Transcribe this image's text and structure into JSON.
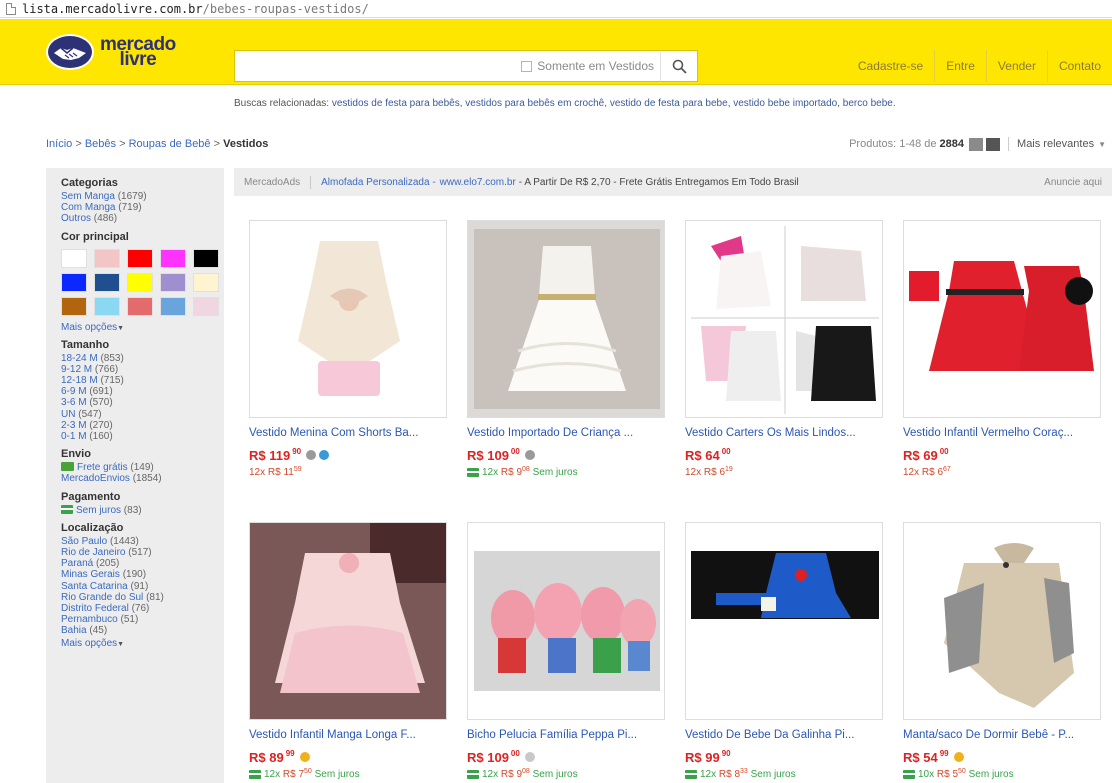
{
  "address_bar": {
    "host": "lista.mercadolivre.com.br",
    "path": "/bebes-roupas-vestidos/"
  },
  "header": {
    "logo_line1": "mercado",
    "logo_line2": "livre",
    "search_placeholder": "",
    "search_filter_label": "Somente em Vestidos",
    "nav": [
      "Cadastre-se",
      "Entre",
      "Vender",
      "Contato"
    ]
  },
  "related": {
    "label": "Buscas relacionadas:",
    "links": [
      "vestidos de festa para bebês",
      "vestidos para bebês em crochê",
      "vestido de festa para bebe",
      "vestido bebe importado",
      "berco bebe"
    ]
  },
  "breadcrumb": {
    "items": [
      "Início",
      "Bebês",
      "Roupas de Bebê"
    ],
    "current": "Vestidos"
  },
  "results": {
    "label": "Produtos:",
    "range": "1-48 de",
    "total": "2884",
    "sort": "Mais relevantes"
  },
  "sidebar": {
    "categories_title": "Categorias",
    "categories": [
      {
        "name": "Sem Manga",
        "count": "(1679)"
      },
      {
        "name": "Com Manga",
        "count": "(719)"
      },
      {
        "name": "Outros",
        "count": "(486)"
      }
    ],
    "color_title": "Cor principal",
    "colors": [
      "#ffffff",
      "#f2c6c4",
      "#ff0000",
      "#ff33ff",
      "#000000",
      "#0c28ff",
      "#1f4f8f",
      "#ffff00",
      "#9f8fcf",
      "#fff4d0",
      "#b0650e",
      "#8ad8f2",
      "#e36b6b",
      "#6aa4dc",
      "#f0d6e0"
    ],
    "more_options": "Mais opções",
    "size_title": "Tamanho",
    "sizes": [
      {
        "name": "18-24 M",
        "count": "(853)"
      },
      {
        "name": "9-12 M",
        "count": "(766)"
      },
      {
        "name": "12-18 M",
        "count": "(715)"
      },
      {
        "name": "6-9 M",
        "count": "(691)"
      },
      {
        "name": "3-6 M",
        "count": "(570)"
      },
      {
        "name": "UN",
        "count": "(547)"
      },
      {
        "name": "2-3 M",
        "count": "(270)"
      },
      {
        "name": "0-1 M",
        "count": "(160)"
      }
    ],
    "shipping_title": "Envio",
    "shipping": [
      {
        "name": "Frete grátis",
        "count": "(149)"
      },
      {
        "name": "MercadoEnvios",
        "count": "(1854)"
      }
    ],
    "payment_title": "Pagamento",
    "payment": [
      {
        "name": "Sem juros",
        "count": "(83)"
      }
    ],
    "location_title": "Localização",
    "locations": [
      {
        "name": "São Paulo",
        "count": "(1443)"
      },
      {
        "name": "Rio de Janeiro",
        "count": "(517)"
      },
      {
        "name": "Paraná",
        "count": "(205)"
      },
      {
        "name": "Minas Gerais",
        "count": "(190)"
      },
      {
        "name": "Santa Catarina",
        "count": "(91)"
      },
      {
        "name": "Rio Grande do Sul",
        "count": "(81)"
      },
      {
        "name": "Distrito Federal",
        "count": "(76)"
      },
      {
        "name": "Pernambuco",
        "count": "(51)"
      },
      {
        "name": "Bahia",
        "count": "(45)"
      }
    ],
    "location_more": "Mais opções"
  },
  "ads": {
    "label": "MercadoAds",
    "title": "Almofada Personalizada -",
    "site": "www.elo7.com.br",
    "desc": "- A Partir De R$ 2,70 - Frete Grátis Entregamos Em Todo Brasil",
    "right": "Anuncie aqui"
  },
  "products": [
    {
      "title": "Vestido Menina Com Shorts Ba...",
      "price": "R$ 119",
      "cents": "90",
      "medal": "#9a9a9a",
      "verified": true,
      "inst_free": false,
      "inst_count": "12x",
      "inst_price": "R$ 11",
      "inst_cents": "59",
      "inst_note": ""
    },
    {
      "title": "Vestido Importado De Criança ...",
      "price": "R$ 109",
      "cents": "00",
      "medal": "#9a9a9a",
      "verified": false,
      "inst_free": true,
      "inst_count": "12x",
      "inst_price": "R$ 9",
      "inst_cents": "08",
      "inst_note": "Sem juros"
    },
    {
      "title": "Vestido Carters Os Mais Lindos...",
      "price": "R$ 64",
      "cents": "00",
      "medal": "",
      "verified": false,
      "inst_free": false,
      "inst_count": "12x",
      "inst_price": "R$ 6",
      "inst_cents": "19",
      "inst_note": ""
    },
    {
      "title": "Vestido Infantil Vermelho Coraç...",
      "price": "R$ 69",
      "cents": "00",
      "medal": "",
      "verified": false,
      "inst_free": false,
      "inst_count": "12x",
      "inst_price": "R$ 6",
      "inst_cents": "67",
      "inst_note": ""
    },
    {
      "title": "Vestido Infantil Manga Longa F...",
      "price": "R$ 89",
      "cents": "99",
      "medal": "#f0b21b",
      "verified": false,
      "inst_free": true,
      "inst_count": "12x",
      "inst_price": "R$ 7",
      "inst_cents": "50",
      "inst_note": "Sem juros"
    },
    {
      "title": "Bicho Pelucia Família Peppa Pi...",
      "price": "R$ 109",
      "cents": "00",
      "medal": "#c8c8c8",
      "verified": false,
      "inst_free": true,
      "inst_count": "12x",
      "inst_price": "R$ 9",
      "inst_cents": "08",
      "inst_note": "Sem juros"
    },
    {
      "title": "Vestido De Bebe Da Galinha Pi...",
      "price": "R$ 99",
      "cents": "90",
      "medal": "",
      "verified": false,
      "inst_free": true,
      "inst_count": "12x",
      "inst_price": "R$ 8",
      "inst_cents": "33",
      "inst_note": "Sem juros"
    },
    {
      "title": "Manta/saco De Dormir Bebê - P...",
      "price": "R$ 54",
      "cents": "99",
      "medal": "#f0b21b",
      "verified": false,
      "inst_free": true,
      "inst_count": "10x",
      "inst_price": "R$ 5",
      "inst_cents": "50",
      "inst_note": "Sem juros"
    }
  ]
}
